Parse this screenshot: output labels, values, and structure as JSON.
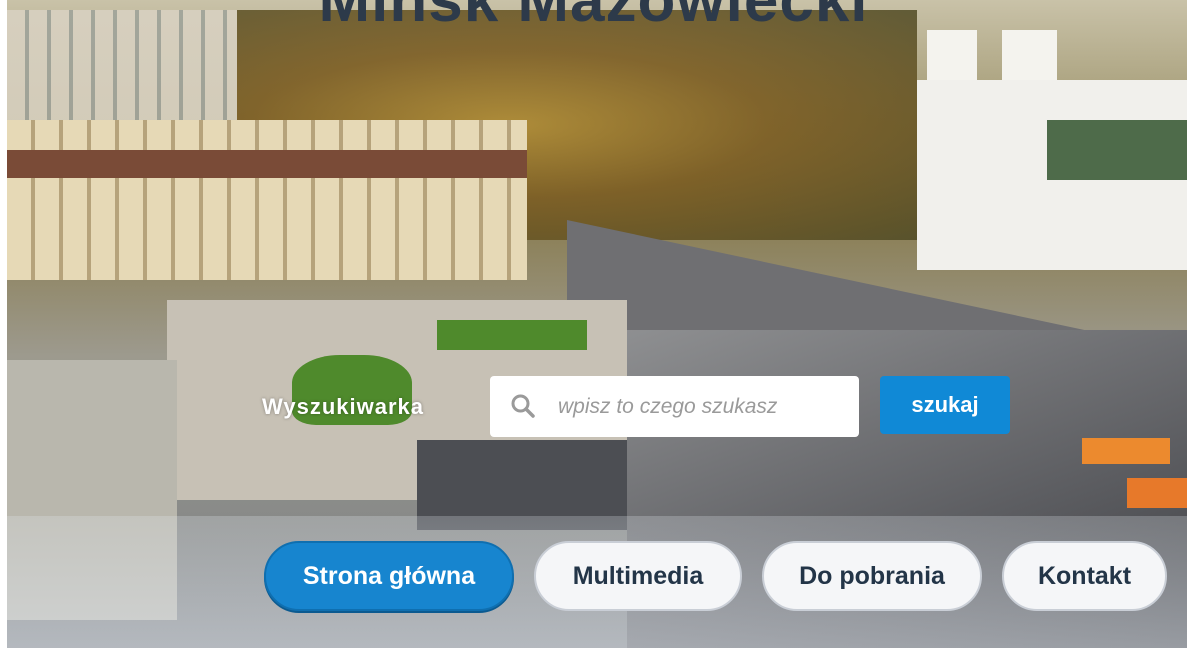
{
  "page": {
    "title": "Mińsk Mazowiecki"
  },
  "search": {
    "label": "Wyszukiwarka",
    "placeholder": "wpisz to czego szukasz",
    "button_label": "szukaj",
    "icon": "search-icon"
  },
  "nav": {
    "items": [
      {
        "label": "Strona główna",
        "active": true
      },
      {
        "label": "Multimedia",
        "active": false
      },
      {
        "label": "Do pobrania",
        "active": false
      },
      {
        "label": "Kontakt",
        "active": false
      }
    ]
  },
  "colors": {
    "accent": "#1089d6",
    "title": "#2d3a4a",
    "nav_text": "#233548"
  }
}
